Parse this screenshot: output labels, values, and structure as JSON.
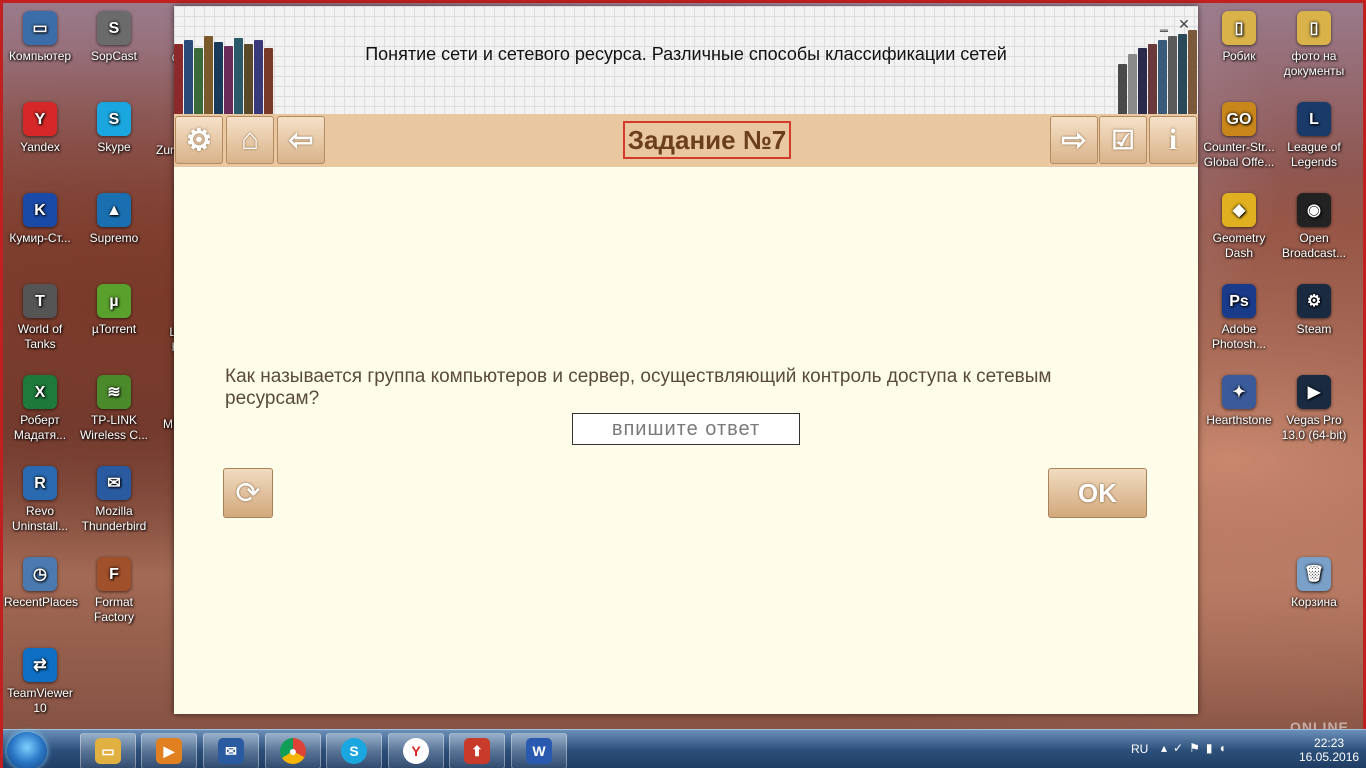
{
  "desktop_left": [
    {
      "label": "Компьютер",
      "color": "#3b6ea8",
      "glyph": "▭"
    },
    {
      "label": "SopCast",
      "color": "#6b6b6b",
      "glyph": "S"
    },
    {
      "label": "Yandex",
      "color": "#d62828",
      "glyph": "Y"
    },
    {
      "label": "Skype",
      "color": "#1aa7e0",
      "glyph": "S"
    },
    {
      "label": "Кумир-Ст...",
      "color": "#1a4aa8",
      "glyph": "K"
    },
    {
      "label": "Supremo",
      "color": "#1a6fb0",
      "glyph": "▲"
    },
    {
      "label": "World of Tanks",
      "color": "#555",
      "glyph": "T"
    },
    {
      "label": "µTorrent",
      "color": "#5aa02c",
      "glyph": "µ"
    },
    {
      "label": "Роберт Мадатя...",
      "color": "#1e7a3a",
      "glyph": "X"
    },
    {
      "label": "TP-LINK Wireless C...",
      "color": "#4a8a2a",
      "glyph": "≋"
    },
    {
      "label": "Revo Uninstall...",
      "color": "#2a6ab0",
      "glyph": "R"
    },
    {
      "label": "Mozilla Thunderbird",
      "color": "#2a5aa0",
      "glyph": "✉"
    },
    {
      "label": "RecentPlaces",
      "color": "#4a7ab0",
      "glyph": "◷"
    },
    {
      "label": "Format Factory",
      "color": "#a0502a",
      "glyph": "F"
    },
    {
      "label": "TeamViewer 10",
      "color": "#0e6fc4",
      "glyph": "⇄"
    }
  ],
  "desktop_right": [
    {
      "label": "Робик",
      "color": "#d9b24a",
      "glyph": "▯"
    },
    {
      "label": "фото на документы",
      "color": "#d9b24a",
      "glyph": "▯"
    },
    {
      "label": "Counter-Str... Global Offe...",
      "color": "#c9861a",
      "glyph": "GO"
    },
    {
      "label": "League of Legends",
      "color": "#1a3a6a",
      "glyph": "L"
    },
    {
      "label": "Geometry Dash",
      "color": "#e0b020",
      "glyph": "◆"
    },
    {
      "label": "Open Broadcast...",
      "color": "#222",
      "glyph": "◉"
    },
    {
      "label": "Adobe Photosh...",
      "color": "#1a3a8a",
      "glyph": "Ps"
    },
    {
      "label": "Steam",
      "color": "#1a2a40",
      "glyph": "⚙"
    },
    {
      "label": "Hearthstone",
      "color": "#3a5a9a",
      "glyph": "✦"
    },
    {
      "label": "Vegas Pro 13.0 (64-bit)",
      "color": "#1a2a40",
      "glyph": "▶"
    },
    {
      "label": "Корзина",
      "color": "#7aa0c8",
      "glyph": "🗑"
    }
  ],
  "partial_labels": [
    "C",
    "Zur",
    "i",
    "Le H",
    "M L"
  ],
  "app": {
    "header_title": "Понятие сети и сетевого ресурса. Различные способы классификации сетей",
    "task_title": "Задание №7",
    "question": "Как называется группа компьютеров и сервер, осуществляющий контроль доступа к сетевым ресурсам?",
    "answer_placeholder": "впишите ответ",
    "ok_label": "OK",
    "toolbar_left": [
      "settings-icon",
      "home-icon",
      "back-arrow-icon"
    ],
    "toolbar_right": [
      "forward-arrow-icon",
      "check-envelope-icon",
      "info-icon"
    ]
  },
  "taskbar": {
    "apps": [
      "explorer",
      "media",
      "thunderbird",
      "chrome",
      "skype",
      "yandex",
      "app",
      "word"
    ],
    "lang": "RU",
    "time": "22:23",
    "date": "16.05.2016",
    "watermark": "ONLINE OTVET.RU"
  }
}
